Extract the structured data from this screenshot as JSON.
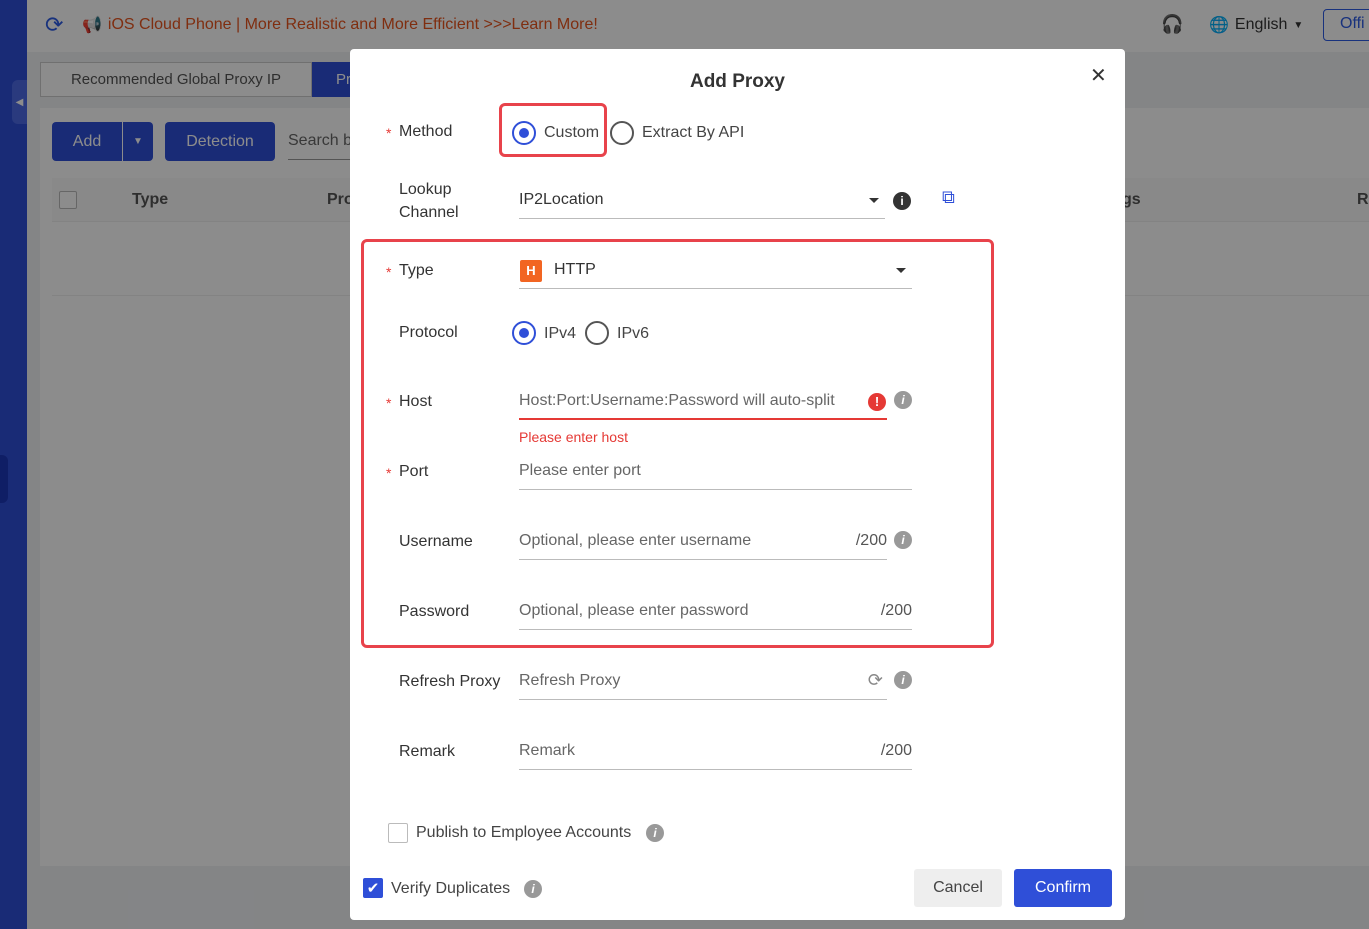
{
  "topbar": {
    "ad_text": "iOS Cloud Phone | More Realistic and More Efficient >>>Learn More!",
    "language": "English",
    "right_button": "Offi"
  },
  "tabs": [
    {
      "label": "Recommended Global Proxy IP"
    },
    {
      "label": "Pr"
    }
  ],
  "toolbar": {
    "add_label": "Add",
    "detection_label": "Detection",
    "search_placeholder": "Search b"
  },
  "table": {
    "headers": [
      "Type",
      "Pro",
      "gs",
      "R"
    ]
  },
  "modal": {
    "title": "Add Proxy",
    "method": {
      "label": "Method",
      "options": [
        "Custom",
        "Extract By API"
      ],
      "selected": "Custom"
    },
    "lookup": {
      "label_line1": "Lookup",
      "label_line2": "Channel",
      "value": "IP2Location"
    },
    "type": {
      "label": "Type",
      "badge": "H",
      "value": "HTTP"
    },
    "protocol": {
      "label": "Protocol",
      "options": [
        "IPv4",
        "IPv6"
      ],
      "selected": "IPv4"
    },
    "host": {
      "label": "Host",
      "placeholder": "Host:Port:Username:Password will auto-split",
      "error": "Please enter host"
    },
    "port": {
      "label": "Port",
      "placeholder": "Please enter port"
    },
    "username": {
      "label": "Username",
      "placeholder": "Optional, please enter username",
      "counter": "/200"
    },
    "password": {
      "label": "Password",
      "placeholder": "Optional, please enter password",
      "counter": "/200"
    },
    "refresh": {
      "label": "Refresh Proxy",
      "placeholder": "Refresh Proxy"
    },
    "remark": {
      "label": "Remark",
      "placeholder": "Remark",
      "counter": "/200"
    },
    "publish": {
      "label": "Publish to Employee Accounts",
      "checked": false
    },
    "verify": {
      "label": "Verify Duplicates",
      "checked": true
    },
    "cancel_label": "Cancel",
    "confirm_label": "Confirm"
  },
  "colors": {
    "primary": "#2f4fd8",
    "error": "#e53935",
    "highlight": "#e8434b",
    "http_badge": "#f26522"
  }
}
